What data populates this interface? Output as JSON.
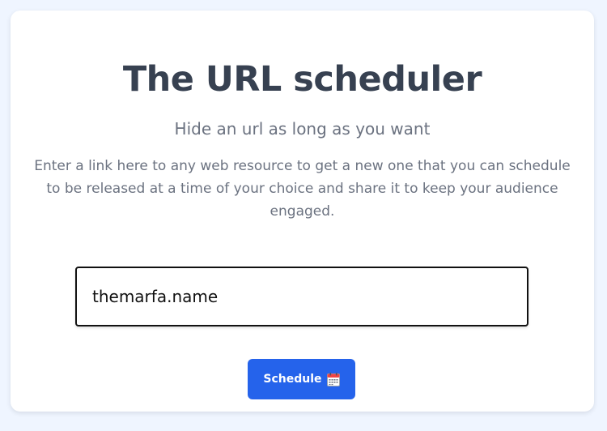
{
  "header": {
    "title": "The URL scheduler",
    "subtitle": "Hide an url as long as you want",
    "description": "Enter a link here to any web resource to get a new one that you can schedule to be released at a time of your choice and share it to keep your audience engaged."
  },
  "form": {
    "url_value": "themarfa.name",
    "schedule_label": "Schedule",
    "schedule_icon": "calendar-icon"
  },
  "colors": {
    "page_background": "#eff5ff",
    "button_background": "#2563eb",
    "title_text": "#374151",
    "muted_text": "#6b7280"
  }
}
